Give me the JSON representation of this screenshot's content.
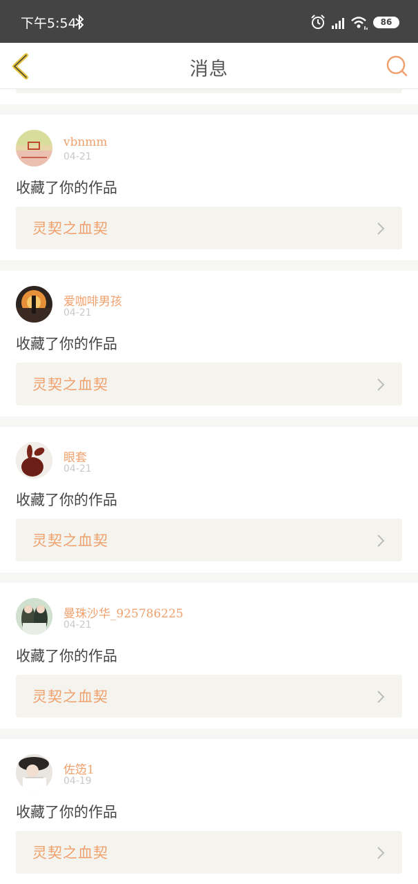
{
  "status_bar": {
    "time": "下午5:54",
    "battery": "86",
    "icons": [
      "bluetooth-icon",
      "alarm-icon",
      "signal-icon",
      "wifi-icon",
      "battery-icon"
    ]
  },
  "nav": {
    "title": "消息",
    "back_icon": "chevron-left-icon",
    "search_icon": "search-icon"
  },
  "colors": {
    "accent": "#f0a06c",
    "back_icon": "#e5c43c",
    "status_bar": "#444444",
    "link_bg": "#f4f3ee",
    "page_bg": "#f6f6f4"
  },
  "messages": [
    {
      "username": "vbnmm",
      "date": "04-21",
      "action": "收藏了你的作品",
      "work_title": "灵契之血契"
    },
    {
      "username": "爱咖啡男孩",
      "date": "04-21",
      "action": "收藏了你的作品",
      "work_title": "灵契之血契"
    },
    {
      "username": "眼套",
      "date": "04-21",
      "action": "收藏了你的作品",
      "work_title": "灵契之血契"
    },
    {
      "username": "曼珠沙华_925786225",
      "date": "04-21",
      "action": "收藏了你的作品",
      "work_title": "灵契之血契"
    },
    {
      "username": "佐笾1",
      "date": "04-19",
      "action": "收藏了你的作品",
      "work_title": "灵契之血契"
    }
  ]
}
